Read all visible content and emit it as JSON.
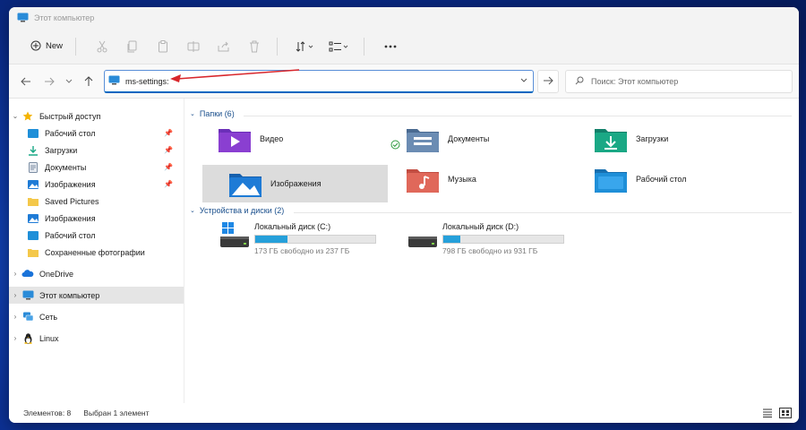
{
  "window": {
    "title": "Этот компьютер"
  },
  "toolbar": {
    "new_label": "New",
    "icons": [
      "cut-icon",
      "copy-icon",
      "paste-icon",
      "rename-icon",
      "share-icon",
      "delete-icon",
      "sort-icon",
      "view-icon",
      "more-icon"
    ]
  },
  "address": {
    "value": "ms-settings:",
    "search_placeholder": "Поиск: Этот компьютер"
  },
  "sidebar": {
    "quick_access": "Быстрый доступ",
    "items": [
      {
        "label": "Рабочий стол",
        "pinned": true
      },
      {
        "label": "Загрузки",
        "pinned": true
      },
      {
        "label": "Документы",
        "pinned": true
      },
      {
        "label": "Изображения",
        "pinned": true
      },
      {
        "label": "Saved Pictures",
        "pinned": false
      },
      {
        "label": "Изображения",
        "pinned": false
      },
      {
        "label": "Рабочий стол",
        "pinned": false
      },
      {
        "label": "Сохраненные фотографии",
        "pinned": false
      }
    ],
    "onedrive": "OneDrive",
    "this_pc": "Этот компьютер",
    "network": "Сеть",
    "linux": "Linux"
  },
  "main": {
    "folders_header": "Папки (6)",
    "folders": [
      {
        "label": "Видео",
        "color": "#8a3fd1"
      },
      {
        "label": "Документы",
        "color": "#5b7fa8"
      },
      {
        "label": "Загрузки",
        "color": "#1aa885"
      },
      {
        "label": "Изображения",
        "color": "#1e7bd6"
      },
      {
        "label": "Музыка",
        "color": "#e0685a"
      },
      {
        "label": "Рабочий стол",
        "color": "#1f8fd8"
      }
    ],
    "drives_header": "Устройства и диски (2)",
    "drives": [
      {
        "name": "Локальный диск (C:)",
        "free_text": "173 ГБ свободно из 237 ГБ",
        "used_fraction": 0.27
      },
      {
        "name": "Локальный диск (D:)",
        "free_text": "798 ГБ свободно из 931 ГБ",
        "used_fraction": 0.14
      }
    ]
  },
  "status": {
    "items_count": "Элементов: 8",
    "selected": "Выбран 1 элемент"
  },
  "colors": {
    "accent": "#0067c0",
    "selection": "#dcdcdc",
    "drive_bar": "#26a0da"
  }
}
